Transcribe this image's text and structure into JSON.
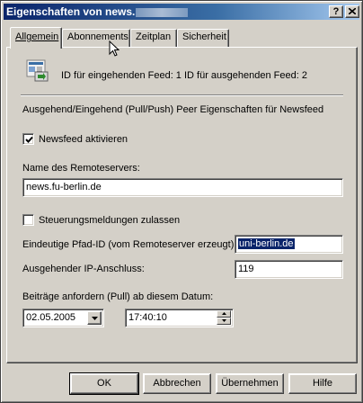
{
  "window": {
    "title": "Eigenschaften von news.",
    "help_btn": "?"
  },
  "tabs": [
    {
      "label": "Allgemein"
    },
    {
      "label": "Abonnements"
    },
    {
      "label": "Zeitplan"
    },
    {
      "label": "Sicherheit"
    }
  ],
  "general": {
    "feed_icon": "newsfeed-icon",
    "feed_ids": "ID für eingehenden Feed: 1   ID für ausgehenden Feed: 2",
    "description": "Ausgehend/Eingehend (Pull/Push) Peer Eigenschaften für Newsfeed",
    "enable_feed": {
      "label": "Newsfeed aktivieren",
      "checked": true
    },
    "remote_server_label": "Name des Remoteservers:",
    "remote_server_value": "news.fu-berlin.de",
    "control_messages": {
      "label": "Steuerungsmeldungen zulassen",
      "checked": false
    },
    "path_id_label": "Eindeutige Pfad-ID (vom Remoteserver erzeugt):",
    "path_id_value": "uni-berlin.de",
    "outgoing_port_label": "Ausgehender IP-Anschluss:",
    "outgoing_port_value": "119",
    "pull_date_label": "Beiträge anfordern (Pull) ab diesem Datum:",
    "date_value": "02.05.2005",
    "time_value": "17:40:10"
  },
  "buttons": {
    "ok": "OK",
    "cancel": "Abbrechen",
    "apply": "Übernehmen",
    "help": "Hilfe"
  }
}
